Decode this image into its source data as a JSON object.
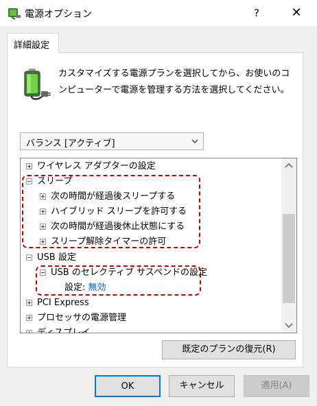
{
  "window": {
    "title": "電源オプション",
    "help_label": "?",
    "close_label": "✕"
  },
  "tab": {
    "label": "詳細設定"
  },
  "description": "カスタマイズする電源プランを選択してから、お使いのコンピューターで電源を管理する方法を選択してください。",
  "plan_select": {
    "value": "バランス [アクティブ]"
  },
  "tree": {
    "items": [
      {
        "label": "ワイヤレス アダプターの設定",
        "expander": "plus"
      },
      {
        "label": "スリープ",
        "expander": "minus"
      },
      {
        "label": "次の時間が経過後スリープする",
        "expander": "plus"
      },
      {
        "label": "ハイブリッド スリープを許可する",
        "expander": "plus"
      },
      {
        "label": "次の時間が経過後休止状態にする",
        "expander": "plus"
      },
      {
        "label": "スリープ解除タイマーの許可",
        "expander": "plus"
      },
      {
        "label": "USB 設定",
        "expander": "minus"
      },
      {
        "label": "USB のセレクティブ サスペンドの設定",
        "expander": "minus"
      },
      {
        "label": "設定:",
        "value": "無効"
      },
      {
        "label": "PCI Express",
        "expander": "plus"
      },
      {
        "label": "プロセッサの電源管理",
        "expander": "plus"
      },
      {
        "label": "ディスプレイ",
        "expander": "plus"
      }
    ]
  },
  "buttons": {
    "restore": "既定のプランの復元(R)",
    "ok": "OK",
    "cancel": "キャンセル",
    "apply": "適用(A)"
  },
  "colors": {
    "highlight_dash": "#c00000",
    "link": "#0066cc",
    "default_button_border": "#0078d7"
  }
}
